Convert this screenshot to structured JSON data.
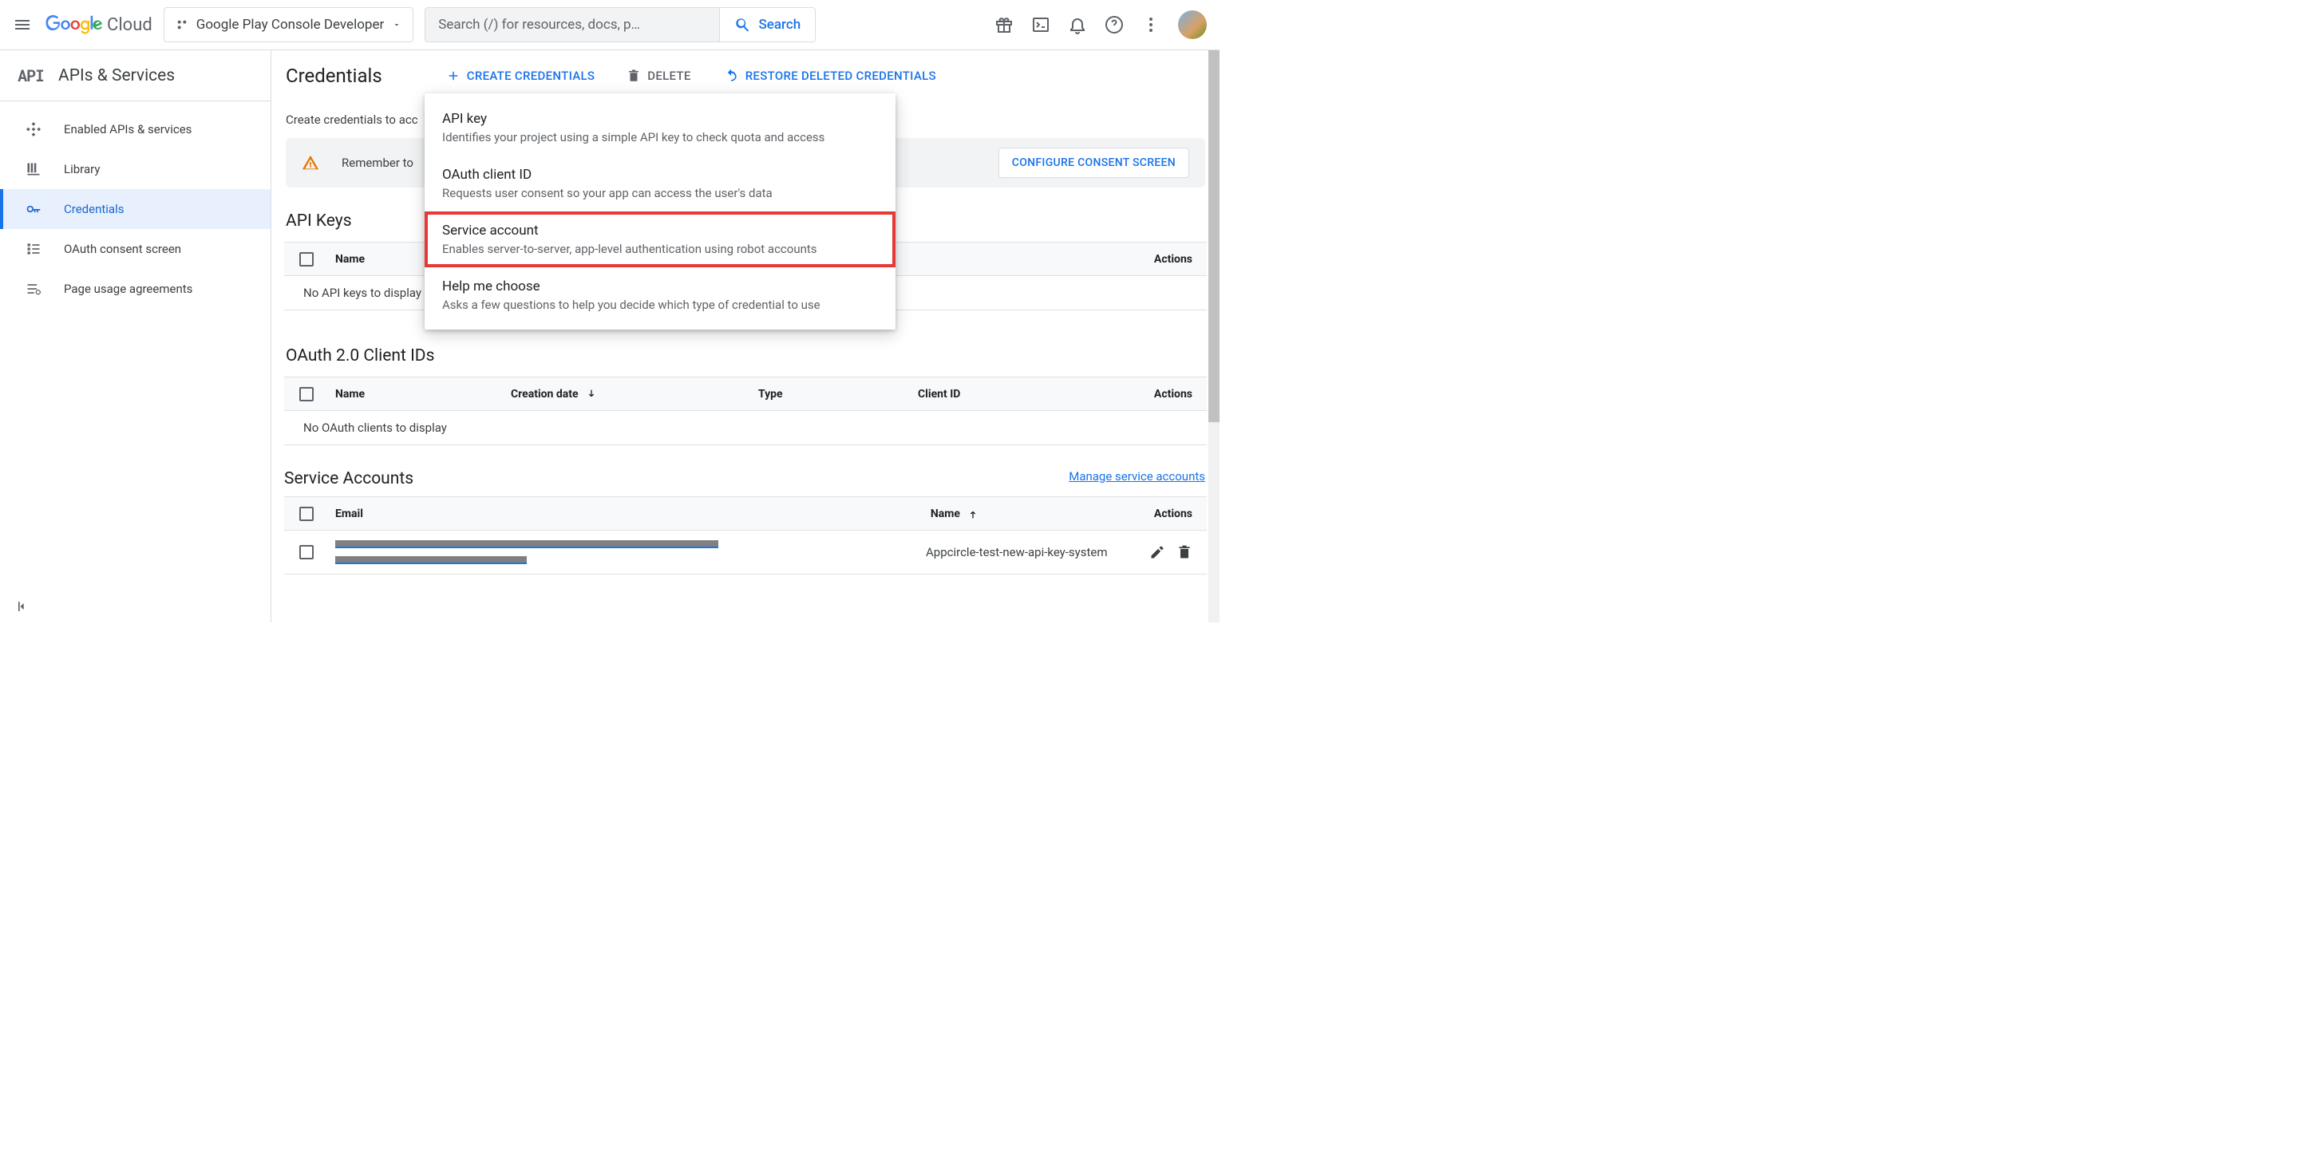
{
  "topbar": {
    "product_name": "Cloud",
    "project_name": "Google Play Console Developer",
    "search_placeholder": "Search (/) for resources, docs, p…",
    "search_button": "Search"
  },
  "sidebar": {
    "section_title": "APIs & Services",
    "glyph": "API",
    "items": [
      {
        "label": "Enabled APIs & services",
        "icon": "grid-diamond"
      },
      {
        "label": "Library",
        "icon": "library"
      },
      {
        "label": "Credentials",
        "icon": "key",
        "active": true
      },
      {
        "label": "OAuth consent screen",
        "icon": "consent"
      },
      {
        "label": "Page usage agreements",
        "icon": "settings-lines"
      }
    ]
  },
  "main": {
    "title": "Credentials",
    "actions": {
      "create": "CREATE CREDENTIALS",
      "delete": "DELETE",
      "restore": "RESTORE DELETED CREDENTIALS"
    },
    "hint": "Create credentials to acc",
    "banner": {
      "text": "Remember to",
      "button": "CONFIGURE CONSENT SCREEN"
    },
    "sections": {
      "api_keys": {
        "title": "API Keys",
        "cols": {
          "name": "Name",
          "actions": "Actions"
        },
        "empty": "No API keys to display"
      },
      "oauth": {
        "title": "OAuth 2.0 Client IDs",
        "cols": {
          "name": "Name",
          "created": "Creation date",
          "type": "Type",
          "client_id": "Client ID",
          "actions": "Actions"
        },
        "empty": "No OAuth clients to display"
      },
      "service": {
        "title": "Service Accounts",
        "manage": "Manage service accounts",
        "cols": {
          "email": "Email",
          "name": "Name",
          "actions": "Actions"
        },
        "rows": [
          {
            "name": "Appcircle-test-new-api-key-system"
          }
        ]
      }
    }
  },
  "dropdown": {
    "items": [
      {
        "title": "API key",
        "sub": "Identifies your project using a simple API key to check quota and access"
      },
      {
        "title": "OAuth client ID",
        "sub": "Requests user consent so your app can access the user's data"
      },
      {
        "title": "Service account",
        "sub": "Enables server-to-server, app-level authentication using robot accounts",
        "highlighted": true
      },
      {
        "title": "Help me choose",
        "sub": "Asks a few questions to help you decide which type of credential to use"
      }
    ]
  }
}
